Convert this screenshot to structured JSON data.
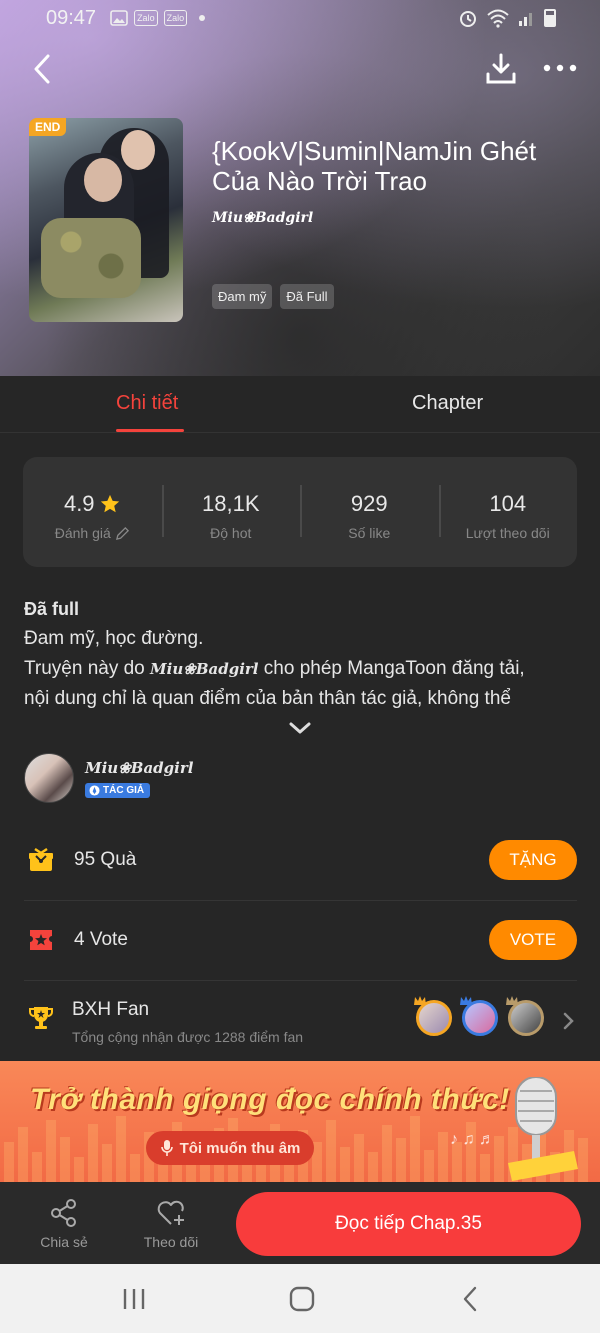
{
  "status_bar": {
    "time": "09:47",
    "app_icons": [
      "Zalo",
      "Zalo"
    ]
  },
  "header": {
    "cover_badge": "END",
    "title": "{KookV|Sumin|NamJin Ghét Của Nào Trời Trao",
    "author": "Miu❀Badgirl",
    "tags": [
      "Đam mỹ",
      "Đã Full"
    ]
  },
  "tabs": {
    "detail": "Chi tiết",
    "chapter": "Chapter"
  },
  "stats": [
    {
      "value": "4.9",
      "label": "Đánh giá",
      "icon": "star-icon"
    },
    {
      "value": "18,1K",
      "label": "Độ hot"
    },
    {
      "value": "929",
      "label": "Số like"
    },
    {
      "value": "104",
      "label": "Lượt theo dõi"
    }
  ],
  "description": {
    "status": "Đã full",
    "genres": "Đam mỹ, học đường.",
    "line_prefix": "Truyện này do ",
    "line_author": "Miu❀Badgirl",
    "line_suffix": " cho phép MangaToon đăng tải,",
    "line2": "nội dung chỉ là quan điểm của bản thân tác giả, không thể"
  },
  "author_row": {
    "name": "Miu❀Badgirl",
    "badge": "TÁC GIẢ"
  },
  "gift_row": {
    "text": "95 Quà",
    "button": "TẶNG"
  },
  "vote_row": {
    "text": "4 Vote",
    "button": "VOTE"
  },
  "fan_row": {
    "title": "BXH Fan",
    "subtitle": "Tổng cộng nhận được 1288 điểm fan"
  },
  "banner": {
    "title": "Trở thành giọng đọc chính thức!",
    "button": "Tôi muốn thu âm"
  },
  "bottom_bar": {
    "share": "Chia sẻ",
    "follow": "Theo dõi",
    "read": "Đọc tiếp Chap.35"
  },
  "colors": {
    "accent_red": "#f4433c",
    "button_orange": "#ff8a00",
    "read_button": "#f83c3c",
    "background": "#262626"
  }
}
